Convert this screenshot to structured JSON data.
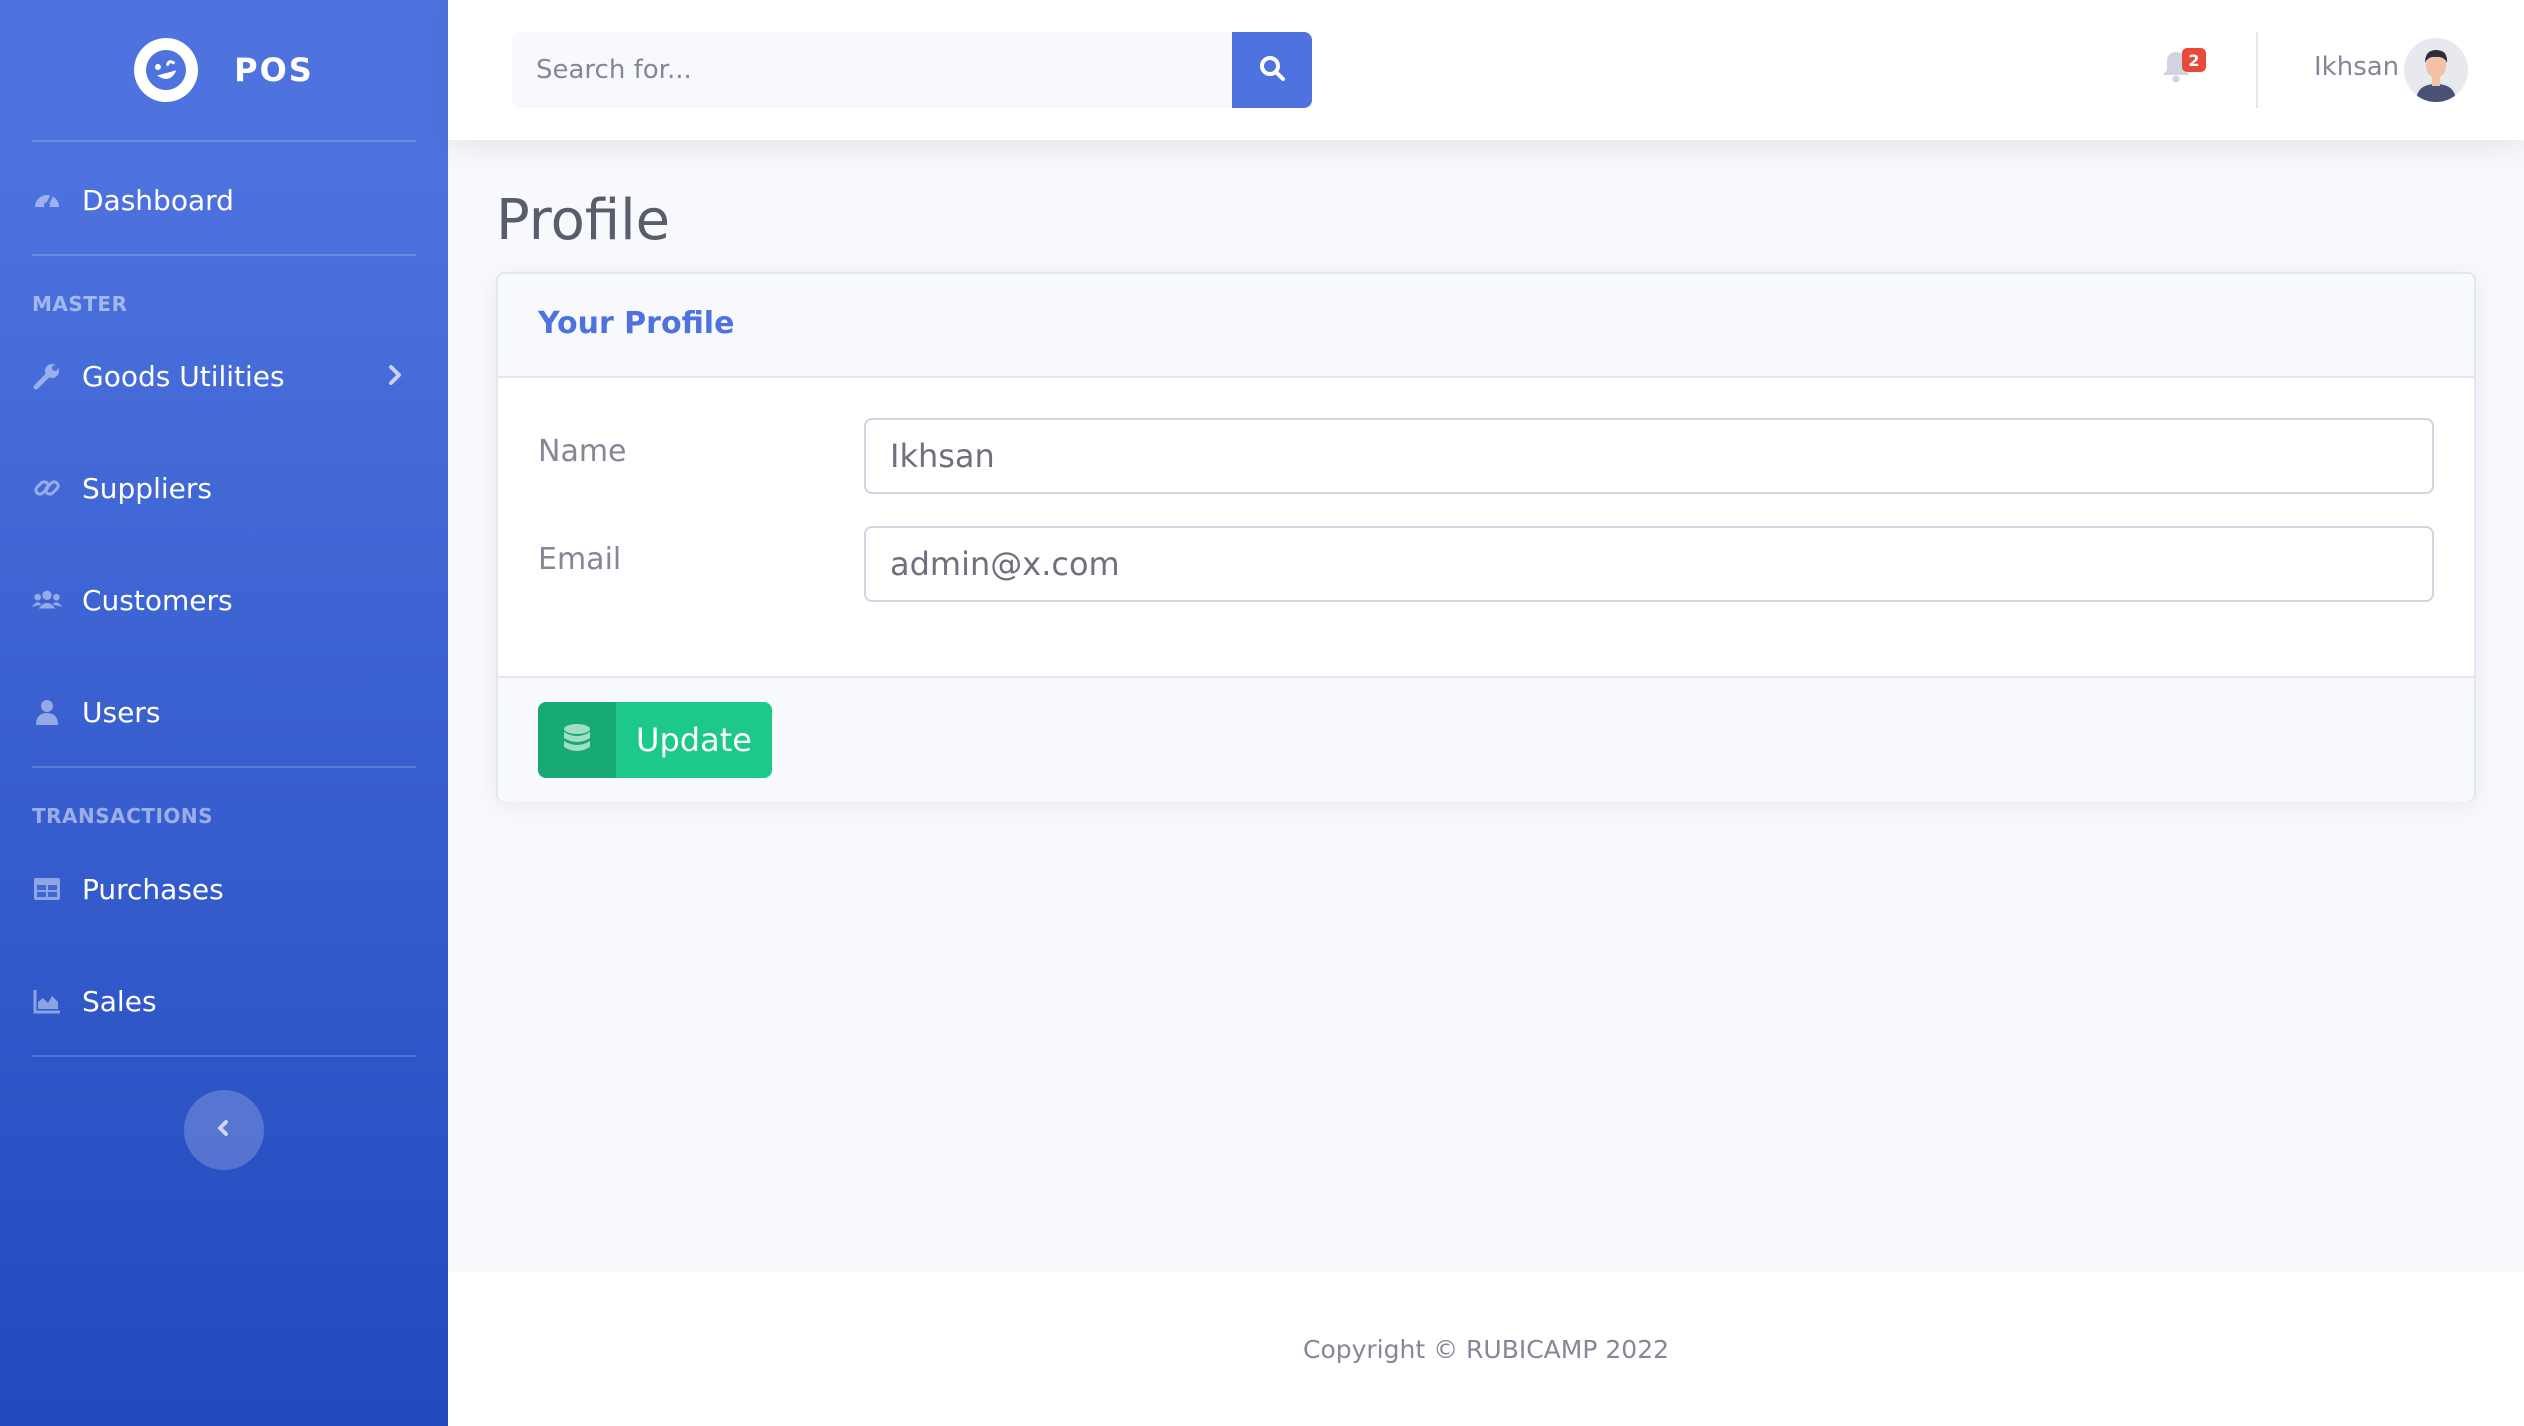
{
  "brand": {
    "name": "POS",
    "logo_icon": "laugh-wink-icon"
  },
  "sidebar": {
    "dashboard": {
      "label": "Dashboard",
      "icon": "tachometer-icon"
    },
    "sections": [
      {
        "heading": "MASTER"
      },
      {
        "heading": "TRANSACTIONS"
      }
    ],
    "items": [
      {
        "label": "Goods Utilities",
        "icon": "wrench-icon"
      },
      {
        "label": "Suppliers",
        "icon": "link-icon"
      },
      {
        "label": "Customers",
        "icon": "users-icon"
      },
      {
        "label": "Users",
        "icon": "user-icon"
      },
      {
        "label": "Purchases",
        "icon": "table-icon"
      },
      {
        "label": "Sales",
        "icon": "area-chart-icon"
      }
    ]
  },
  "topbar": {
    "search_placeholder": "Search for...",
    "notification_count": "2",
    "user_name": "Ikhsan"
  },
  "page": {
    "title": "Profile"
  },
  "profile_card": {
    "title": "Your Profile",
    "fields": [
      {
        "label": "Name",
        "value": "Ikhsan"
      },
      {
        "label": "Email",
        "value": "admin@x.com"
      }
    ],
    "update_label": "Update"
  },
  "footer": {
    "copyright": "Copyright © RUBICAMP 2022"
  },
  "colors": {
    "primary": "#4e73df",
    "success": "#1cc88a",
    "danger": "#e74a3b",
    "text_gray": "#858796"
  }
}
